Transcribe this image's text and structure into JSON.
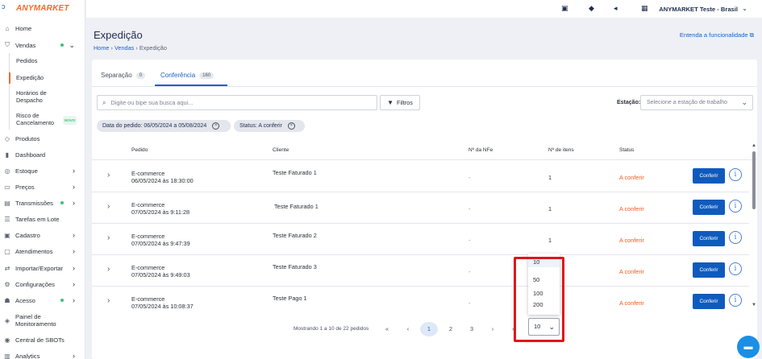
{
  "app": {
    "brand": "ANYMARKET"
  },
  "sidebar": {
    "items": [
      {
        "label": "Home",
        "icon": "home-icon",
        "glyph": "⌂"
      },
      {
        "label": "Vendas",
        "icon": "cart-icon",
        "glyph": "⛉"
      },
      {
        "label": "Produtos",
        "icon": "tag-icon",
        "glyph": "◇"
      },
      {
        "label": "Dashboard",
        "icon": "bar-chart-icon",
        "glyph": "▮"
      },
      {
        "label": "Estoque",
        "icon": "box-icon",
        "glyph": "◎"
      },
      {
        "label": "Preços",
        "icon": "money-icon",
        "glyph": "▭"
      },
      {
        "label": "Transmissões",
        "icon": "transmission-icon",
        "glyph": "▤"
      },
      {
        "label": "Tarefas em Lote",
        "icon": "list-icon",
        "glyph": "☰"
      },
      {
        "label": "Cadastro",
        "icon": "register-icon",
        "glyph": "▣"
      },
      {
        "label": "Atendimentos",
        "icon": "chat-icon",
        "glyph": "▢"
      },
      {
        "label": "Importar/Exportar",
        "icon": "import-export-icon",
        "glyph": "⇄"
      },
      {
        "label": "Configurações",
        "icon": "gear-icon",
        "glyph": "⚙"
      },
      {
        "label": "Acesso",
        "icon": "users-icon",
        "glyph": "☗"
      },
      {
        "label": "Painel de Monitoramento",
        "icon": "monitor-icon",
        "glyph": "◈"
      },
      {
        "label": "Central de SBOTs",
        "icon": "bot-icon",
        "glyph": "◉"
      },
      {
        "label": "Analytics",
        "icon": "analytics-icon",
        "glyph": "▥"
      }
    ],
    "vendas_sub": [
      {
        "label": "Pedidos"
      },
      {
        "label": "Expedição"
      },
      {
        "label": "Horários de Despacho"
      },
      {
        "label": "Risco de Cancelamento",
        "badge": "NOVO"
      }
    ]
  },
  "topbar": {
    "account": "ANYMARKET Teste - Brasil"
  },
  "page": {
    "title": "Expedição",
    "breadcrumb": [
      "Home",
      "Vendas",
      "Expedição"
    ],
    "learn_link": "Entenda a funcionalidade"
  },
  "tabs": [
    {
      "label": "Separação",
      "count": "0"
    },
    {
      "label": "Conferência",
      "count": "160"
    }
  ],
  "search": {
    "placeholder": "Digite ou bipe sua busca aqui..."
  },
  "filters_label": "Filtros",
  "station": {
    "label": "Estação:",
    "placeholder": "Selecione a estação de trabalho"
  },
  "chips": [
    "Data do pedido: 06/05/2024 a 05/08/2024",
    "Status: A conferir"
  ],
  "table": {
    "columns": [
      "Pedido",
      "Cliente",
      "Nº da NFe",
      "Nº de itens",
      "Status"
    ],
    "rows": [
      {
        "channel": "E-commerce",
        "date": "06/05/2024 às 18:30:00",
        "client": "Teste Faturado 1",
        "nfe": "-",
        "items": "1",
        "status": "A conferir",
        "action": "Conferir"
      },
      {
        "channel": "E-commerce",
        "date": "07/05/2024 às 9:11:28",
        "client": "Teste Faturado 1",
        "nfe": "-",
        "items": "1",
        "status": "A conferir",
        "action": "Conferir"
      },
      {
        "channel": "E-commerce",
        "date": "07/05/2024 às 9:47:39",
        "client": "Teste Faturado 2",
        "nfe": "-",
        "items": "1",
        "status": "A conferir",
        "action": "Conferir"
      },
      {
        "channel": "E-commerce",
        "date": "07/05/2024 às 9:49:03",
        "client": "Teste Faturado 3",
        "nfe": "-",
        "items": "1",
        "status": "A conferir",
        "action": "Conferir"
      },
      {
        "channel": "E-commerce",
        "date": "07/05/2024 às 10:08:37",
        "client": "Teste Pago 1",
        "nfe": "-",
        "items": "1",
        "status": "A conferir",
        "action": "Conferir"
      }
    ]
  },
  "pagination": {
    "info": "Mostrando 1 a 10 de 22 pedidos",
    "pages": [
      "1",
      "2",
      "3"
    ],
    "per_page": "10",
    "per_page_options": [
      "10",
      "50",
      "100",
      "200"
    ]
  },
  "colors": {
    "accent": "#1b5fc9",
    "brand": "#f26a2e",
    "status": "#f05a1e",
    "highlight": "#e0141b"
  }
}
